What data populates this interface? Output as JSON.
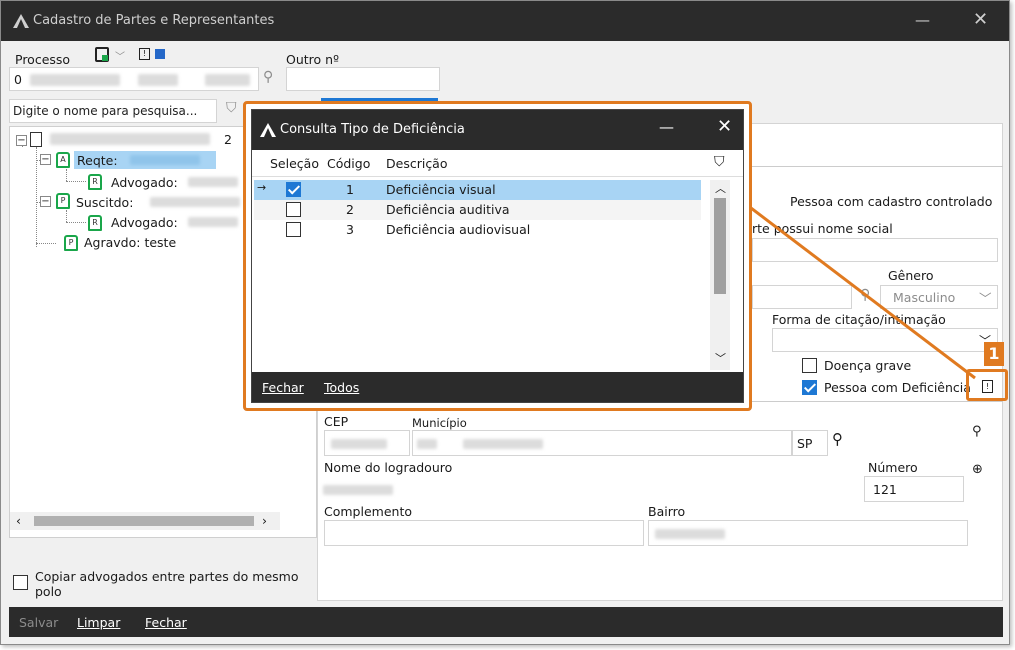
{
  "window": {
    "title": "Cadastro de Partes e Representantes",
    "minimize": "—",
    "close": "✕"
  },
  "processo": {
    "label": "Processo",
    "value_prefix": "0",
    "outro_label": "Outro nº"
  },
  "search": {
    "placeholder": "Digite o nome para pesquisa..."
  },
  "tree": {
    "items": [
      {
        "label": "Reqte:",
        "type": "party"
      },
      {
        "label": "Advogado:",
        "type": "lawyer"
      },
      {
        "label": "Suscitdo:",
        "type": "party"
      },
      {
        "label": "Advogado:",
        "type": "lawyer"
      },
      {
        "label": "Agravdo: teste",
        "type": "party"
      }
    ],
    "root_suffix": "2"
  },
  "copy_lawyers": {
    "label": "Copiar advogados entre partes do mesmo polo"
  },
  "form": {
    "cadastro_controlado": "Pessoa com cadastro controlado",
    "nome_social": "rte possui nome social",
    "genero_label": "Gênero",
    "genero_value": "Masculino",
    "forma_citacao": "Forma de citação/intimação",
    "doenca_grave": "Doença grave",
    "pessoa_deficiencia": "Pessoa com Deficiência",
    "cep_label": "CEP",
    "municipio_label": "Município",
    "uf": "SP",
    "logradouro_label": "Nome do logradouro",
    "numero_label": "Número",
    "numero_value": "121",
    "complemento_label": "Complemento",
    "bairro_label": "Bairro"
  },
  "bottom": {
    "salvar": "Salvar",
    "limpar": "Limpar",
    "fechar": "Fechar"
  },
  "dialog": {
    "title": "Consulta Tipo de Deficiência",
    "minimize": "—",
    "close": "✕",
    "columns": [
      "Seleção",
      "Código",
      "Descrição"
    ],
    "rows": [
      {
        "code": "1",
        "desc": "Deficiência visual",
        "checked": true,
        "selected": true
      },
      {
        "code": "2",
        "desc": "Deficiência auditiva",
        "checked": false,
        "selected": false
      },
      {
        "code": "3",
        "desc": "Deficiência audiovisual",
        "checked": false,
        "selected": false
      }
    ],
    "footer": {
      "fechar": "Fechar",
      "todos": "Todos"
    }
  },
  "annotation": {
    "badge": "1",
    "color": "#e07a20"
  }
}
